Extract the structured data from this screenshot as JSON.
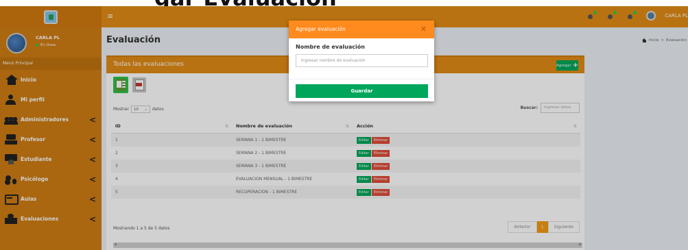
{
  "top_title_partial": "gar Evaluación",
  "header": {
    "menu_icon": "hamburger-icon",
    "user_name": "CARLA PL"
  },
  "sidebar": {
    "user_name": "CARLA PL",
    "status": "En línea",
    "menu_title": "Menú Principal",
    "items": [
      {
        "label": "Inicio",
        "icon": "home-icon"
      },
      {
        "label": "Mi perfil",
        "icon": "user-icon"
      },
      {
        "label": "Administradores",
        "icon": "group-icon"
      },
      {
        "label": "Profesor",
        "icon": "teacher-icon"
      },
      {
        "label": "Estudiante",
        "icon": "student-icon"
      },
      {
        "label": "Psicólogo",
        "icon": "psychologist-icon"
      },
      {
        "label": "Aulas",
        "icon": "classroom-icon"
      },
      {
        "label": "Evaluaciones",
        "icon": "evaluation-icon"
      }
    ]
  },
  "page": {
    "title": "Evaluación",
    "breadcrumb_home": "Inicio",
    "breadcrumb_sep": ">",
    "breadcrumb_current": "Evaluación"
  },
  "box": {
    "title": "Todas las evaluaciones",
    "add_label": "Agregar",
    "show_prefix": "Mostrar",
    "show_value": "10",
    "show_suffix": "datos",
    "search_label": "Buscar:",
    "search_placeholder": "Ingresar datos",
    "columns": [
      "ID",
      "Nombre de evaluación",
      "Acción"
    ],
    "rows": [
      {
        "id": "1",
        "name": "SEMANA 1 - 1 BIMESTRE"
      },
      {
        "id": "2",
        "name": "SEMANA 2 - 1 BIMESTRE"
      },
      {
        "id": "3",
        "name": "SEMANA 3 - 1 BIMESTRE"
      },
      {
        "id": "4",
        "name": "EVALUACION MENSUAL - 1 BIMESTRE"
      },
      {
        "id": "5",
        "name": "RECUPERACION - 1 BIMESTRE"
      }
    ],
    "edit_label": "Editar",
    "delete_label": "Eliminar",
    "info": "Mostrando 1 a 5 de 5 datos",
    "prev": "Anterior",
    "page": "1",
    "next": "Siguiente"
  },
  "modal": {
    "title": "Agregar evaluación",
    "close": "✕",
    "field_label": "Nombre de evaluación",
    "field_placeholder": "Ingresar nombre de evaluación",
    "save_label": "Guardar"
  },
  "colors": {
    "header": "#e18b17",
    "sidebar": "#d07e14",
    "modal_header": "#ff8a1d",
    "success": "#00a65a",
    "danger": "#dd4b39"
  }
}
